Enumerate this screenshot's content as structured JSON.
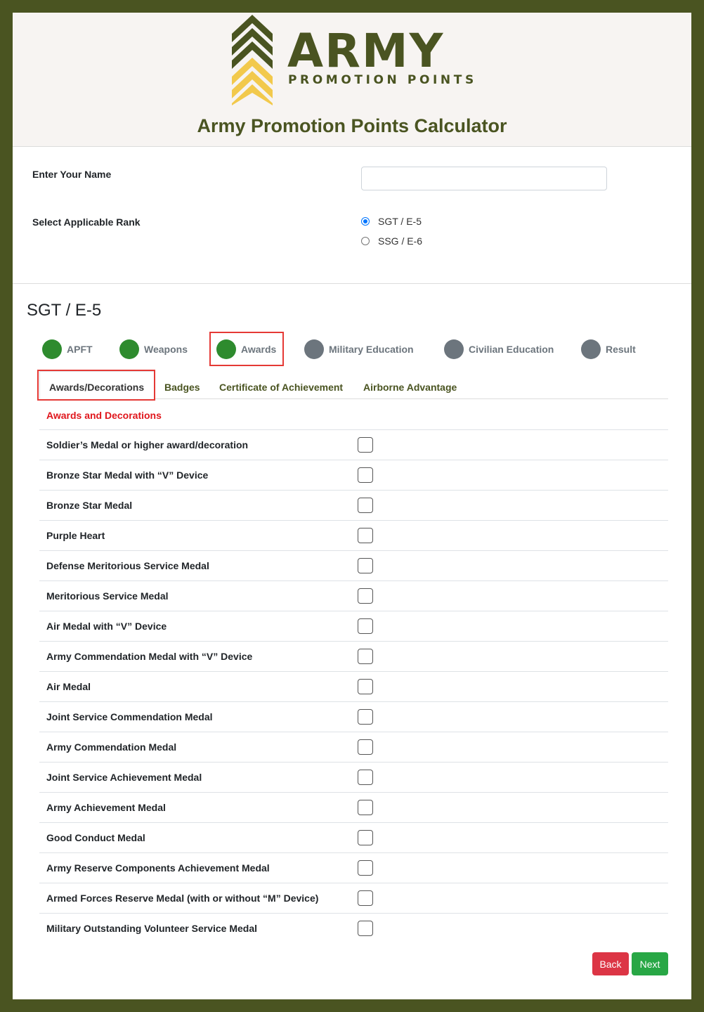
{
  "brand": {
    "logo_word": "ARMY",
    "logo_sub": "PROMOTION POINTS",
    "colors": {
      "olive": "#4a5421",
      "gold": "#f2c94c",
      "green": "#2e8b2e",
      "gray": "#6c757d",
      "red": "#e0161c"
    }
  },
  "page_title": "Army Promotion Points Calculator",
  "form": {
    "name_label": "Enter Your Name",
    "name_value": "",
    "rank_label": "Select Applicable Rank",
    "rank_options": [
      "SGT / E-5",
      "SSG / E-6"
    ],
    "rank_selected": "SGT / E-5"
  },
  "rank_heading": "SGT / E-5",
  "steps": [
    {
      "label": "APFT",
      "status": "done"
    },
    {
      "label": "Weapons",
      "status": "done"
    },
    {
      "label": "Awards",
      "status": "done"
    },
    {
      "label": "Military Education",
      "status": "todo"
    },
    {
      "label": "Civilian Education",
      "status": "todo"
    },
    {
      "label": "Result",
      "status": "todo"
    }
  ],
  "tabs": [
    "Awards/Decorations",
    "Badges",
    "Certificate of Achievement",
    "Airborne Advantage"
  ],
  "active_tab": "Awards/Decorations",
  "section_title": "Awards and Decorations",
  "awards": [
    "Soldier’s Medal or higher award/decoration",
    "Bronze Star Medal with “V” Device",
    "Bronze Star Medal",
    "Purple Heart",
    "Defense Meritorious Service Medal",
    "Meritorious Service Medal",
    "Air Medal with “V” Device",
    "Army Commendation Medal with “V” Device",
    "Air Medal",
    "Joint Service Commendation Medal",
    "Army Commendation Medal",
    "Joint Service Achievement Medal",
    "Army Achievement Medal",
    "Good Conduct Medal",
    "Army Reserve Components Achievement Medal",
    "Armed Forces Reserve Medal (with or without “M” Device)",
    "Military Outstanding Volunteer Service Medal"
  ],
  "buttons": {
    "back": "Back",
    "next": "Next"
  }
}
